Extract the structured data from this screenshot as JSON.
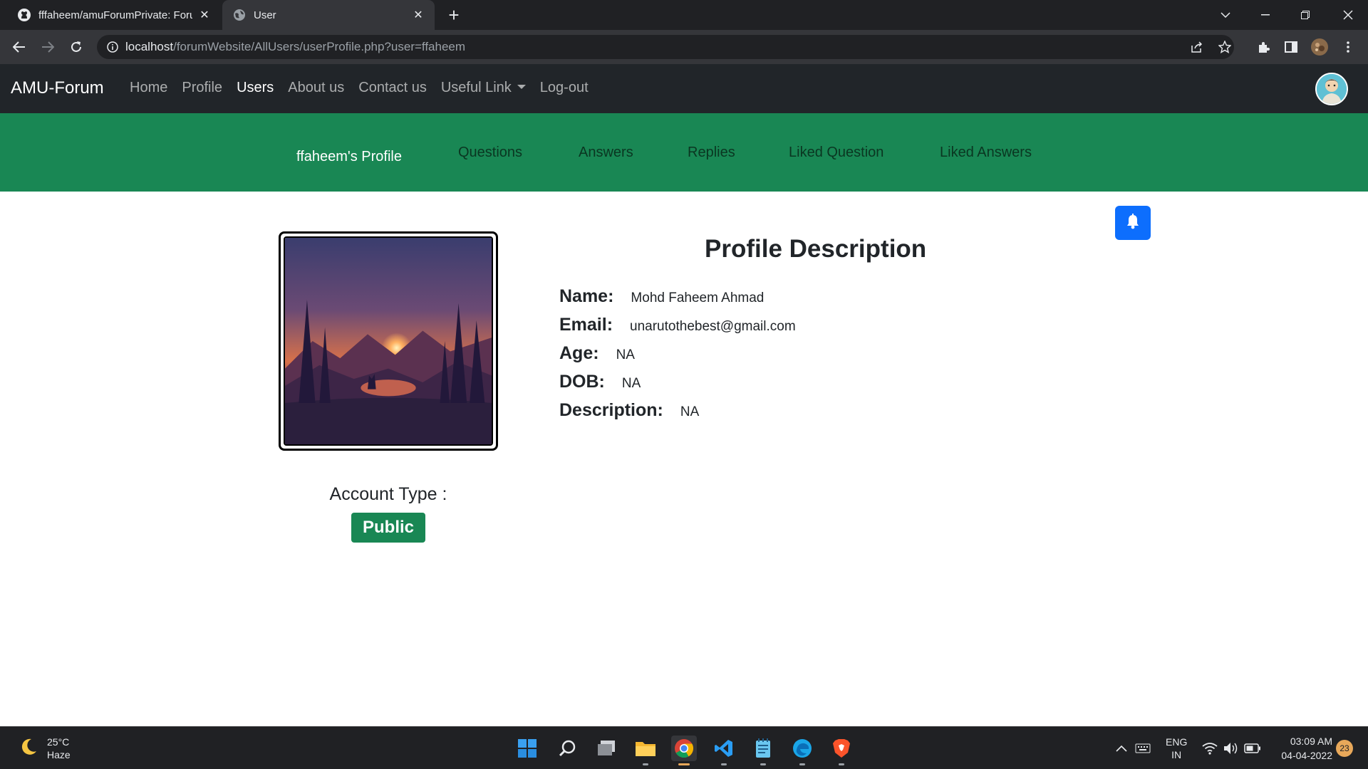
{
  "browser": {
    "tabs": [
      {
        "title": "fffaheem/amuForumPrivate: Foru",
        "icon": "github-icon",
        "active": false
      },
      {
        "title": "User",
        "icon": "globe-icon",
        "active": true
      }
    ],
    "new_tab": "+",
    "url_host": "localhost",
    "url_path": "/forumWebsite/AllUsers/userProfile.php?user=ffaheem"
  },
  "site": {
    "brand": "AMU-Forum",
    "nav": [
      "Home",
      "Profile",
      "Users",
      "About us",
      "Contact us",
      "Useful Link",
      "Log-out"
    ],
    "active_nav": "Users"
  },
  "profile_nav": {
    "title": "ffaheem's Profile",
    "links": [
      "Questions",
      "Answers",
      "Replies",
      "Liked Question",
      "Liked Answers"
    ]
  },
  "profile": {
    "heading": "Profile Description",
    "fields": [
      {
        "label": "Name:",
        "value": "Mohd Faheem Ahmad"
      },
      {
        "label": "Email:",
        "value": "unarutothebest@gmail.com"
      },
      {
        "label": "Age:",
        "value": "NA"
      },
      {
        "label": "DOB:",
        "value": "NA"
      },
      {
        "label": "Description:",
        "value": "NA"
      }
    ],
    "account_type_label": "Account Type :",
    "account_type": "Public"
  },
  "taskbar": {
    "weather_temp": "25°C",
    "weather_desc": "Haze",
    "lang_top": "ENG",
    "lang_bottom": "IN",
    "time": "03:09 AM",
    "date": "04-04-2022",
    "notifications": "23"
  },
  "colors": {
    "navbar": "#212529",
    "subnav": "#198754",
    "badge": "#198754",
    "bell_button": "#0d6efd"
  }
}
